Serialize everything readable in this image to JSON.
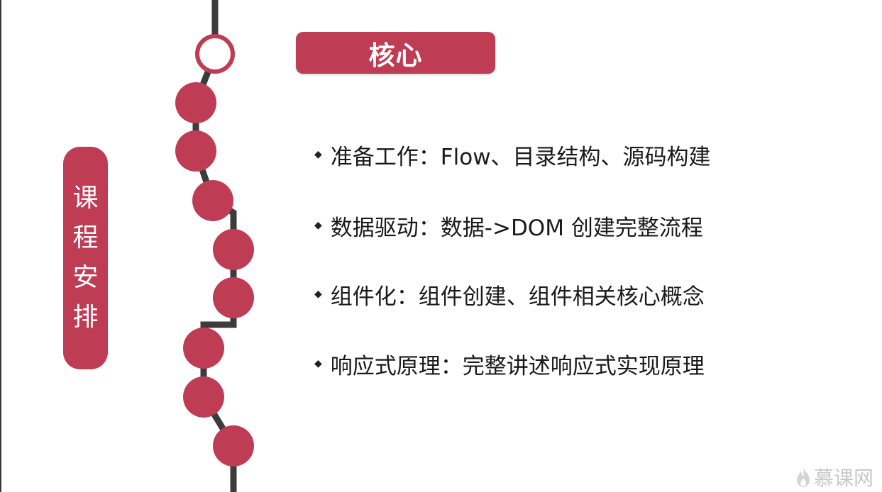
{
  "header": {
    "title": "核心"
  },
  "side_label": {
    "chars": [
      "课",
      "程",
      "安",
      "排"
    ]
  },
  "bullets": [
    {
      "text": "准备工作：Flow、目录结构、源码构建"
    },
    {
      "text": "数据驱动：数据->DOM 创建完整流程"
    },
    {
      "text": "组件化：组件创建、组件相关核心概念"
    },
    {
      "text": "响应式原理：完整讲述响应式实现原理"
    }
  ],
  "logo": {
    "text": "慕课网",
    "icon": "flame-icon"
  },
  "colors": {
    "accent": "#be3c54",
    "line": "#3c3c3c",
    "logo": "#c9c9c9"
  }
}
